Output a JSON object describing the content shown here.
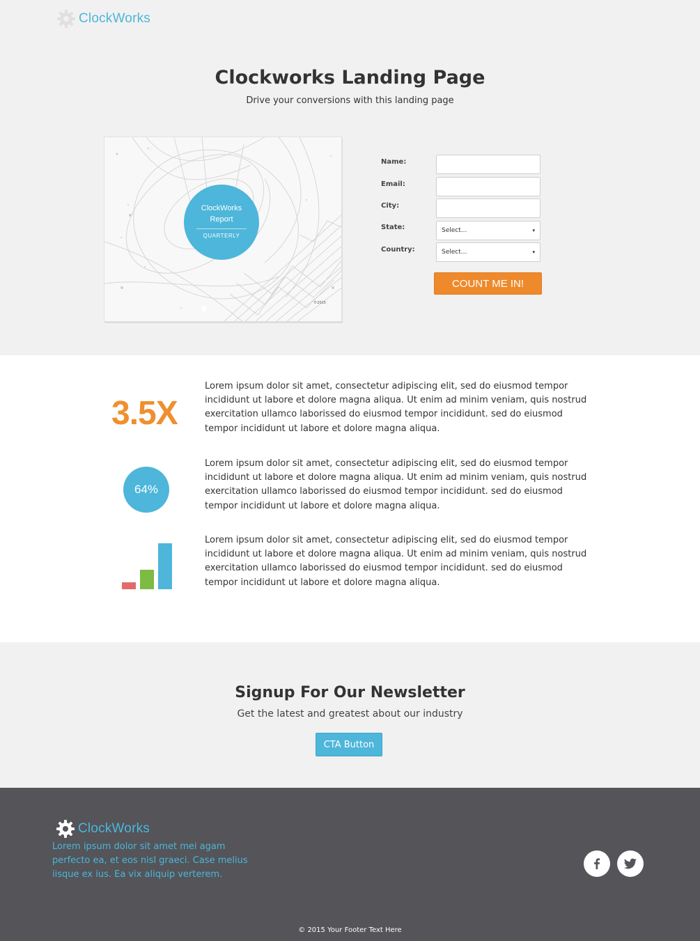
{
  "brand": {
    "name": "ClockWorks",
    "accent_color": "#4db6da",
    "cta_color": "#ee8a2c"
  },
  "hero": {
    "title": "Clockworks Landing Page",
    "subtitle": "Drive your conversions with this landing page",
    "report": {
      "title_line1": "ClockWorks",
      "title_line2": "Report",
      "subtitle": "QUARTERLY",
      "copyright": "©2015"
    }
  },
  "form": {
    "fields": [
      {
        "label": "Name:",
        "value": ""
      },
      {
        "label": "Email:",
        "value": ""
      },
      {
        "label": "City:",
        "value": ""
      }
    ],
    "selects": [
      {
        "label": "State:",
        "value": "Select..."
      },
      {
        "label": "Country:",
        "value": "Select..."
      }
    ],
    "submit_label": "COUNT ME IN!"
  },
  "features": [
    {
      "icon": "multiplier-stat",
      "stat": "3.5X",
      "text": "Lorem ipsum dolor sit amet, consectetur adipiscing elit, sed do eiusmod tempor incididunt ut labore et dolore magna aliqua. Ut enim ad minim veniam, quis nostrud exercitation ullamco laborissed do eiusmod tempor incididunt. sed do eiusmod tempor incididunt ut labore et dolore magna aliqua."
    },
    {
      "icon": "percent-circle",
      "stat": "64%",
      "text": "Lorem ipsum dolor sit amet, consectetur adipiscing elit, sed do eiusmod tempor incididunt ut labore et dolore magna aliqua. Ut enim ad minim veniam, quis nostrud exercitation ullamco laborissed do eiusmod tempor incididunt. sed do eiusmod tempor incididunt ut labore et dolore magna aliqua."
    },
    {
      "icon": "bar-chart-icon",
      "stat": "",
      "text": "Lorem ipsum dolor sit amet, consectetur adipiscing elit, sed do eiusmod tempor incididunt ut labore et dolore magna aliqua. Ut enim ad minim veniam, quis nostrud exercitation ullamco laborissed do eiusmod tempor incididunt. sed do eiusmod tempor incididunt ut labore et dolore magna aliqua."
    }
  ],
  "bar_icon_colors": [
    "#e36a6a",
    "#7dbb42",
    "#4db6da"
  ],
  "newsletter": {
    "title": "Signup For Our Newsletter",
    "subtitle": "Get the latest and greatest about our industry",
    "cta_label": "CTA Button"
  },
  "footer": {
    "text": "Lorem ipsum dolor sit amet mei agam perfecto ea, et eos nisl graeci. Case melius iisque ex ius. Ea vix aliquip verterem.",
    "social": [
      "facebook-icon",
      "twitter-icon"
    ],
    "copyright": "© 2015 Your Footer Text Here"
  }
}
